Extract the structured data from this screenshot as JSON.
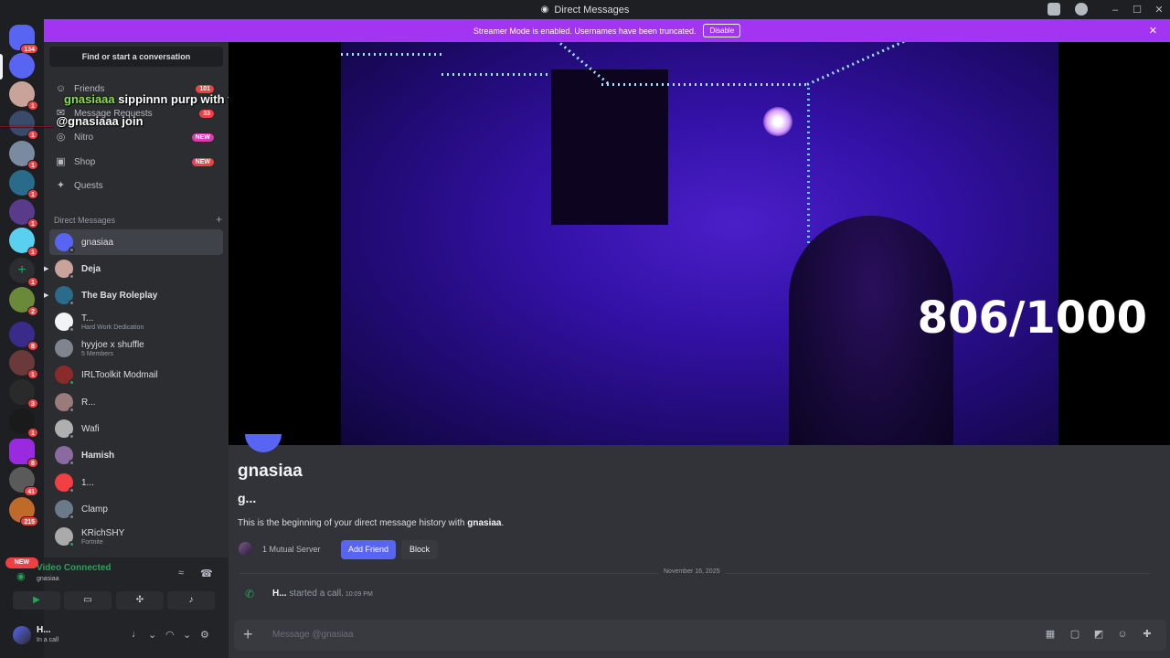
{
  "titlebar": {
    "title": "Direct Messages",
    "minimize": "–",
    "maximize": "☐",
    "close": "✕"
  },
  "streamer_mode": {
    "message": "Streamer Mode is enabled. Usernames have been truncated.",
    "disable_label": "Disable",
    "close": "✕"
  },
  "servers": {
    "home_badge": "134",
    "badges": [
      "1",
      "1",
      "1",
      "1",
      "1",
      "1",
      "1",
      "2",
      "8",
      "1",
      "3",
      "1",
      "8",
      "41",
      "215",
      "1"
    ],
    "new_label": "NEW"
  },
  "overlay_chat": [
    {
      "user": "gnasiaaa",
      "message": "sippinnn purp with the guysss"
    },
    {
      "user": "________",
      "message": "@gnasiaaa join"
    }
  ],
  "sidebar": {
    "find_label": "Find or start a conversation",
    "nav": [
      {
        "label": "Friends",
        "badge": "101",
        "icon": "friends-icon"
      },
      {
        "label": "Message Requests",
        "badge": "33",
        "icon": "mail-icon"
      },
      {
        "label": "Nitro",
        "badge": "NEW",
        "icon": "nitro-icon"
      },
      {
        "label": "Shop",
        "badge": "NEW",
        "icon": "shop-icon"
      },
      {
        "label": "Quests",
        "badge": "",
        "icon": "quests-icon"
      }
    ],
    "dm_header": "Direct Messages",
    "dm_header_plus": "+",
    "dms": [
      {
        "name": "gnasiaa",
        "sub": ""
      },
      {
        "name": "Deja",
        "sub": ""
      },
      {
        "name": "The Bay Roleplay",
        "sub": ""
      },
      {
        "name": "T...",
        "sub": "Hard Work Dedication"
      },
      {
        "name": "hyyjoe x shuffle",
        "sub": "5 Members"
      },
      {
        "name": "IRLToolkit Modmail",
        "sub": ""
      },
      {
        "name": "R...",
        "sub": ""
      },
      {
        "name": "Wafi",
        "sub": ""
      },
      {
        "name": "Hamish",
        "sub": ""
      },
      {
        "name": "1...",
        "sub": ""
      },
      {
        "name": "Clamp",
        "sub": ""
      },
      {
        "name": "KRichSHY",
        "sub": "Fortnite"
      }
    ]
  },
  "voice": {
    "status": "Video Connected",
    "channel": "gnasiaa",
    "buttons": [
      "video-icon",
      "screenshare-icon",
      "activities-icon",
      "soundboard-icon"
    ]
  },
  "me": {
    "name": "H...",
    "status": "In a call"
  },
  "stream": {
    "counter": "806/1000"
  },
  "profile": {
    "name": "gnasiaa",
    "handle": "g...",
    "begin_prefix": "This is the beginning of your direct message history with ",
    "begin_user": "gnasiaa",
    "begin_suffix": ".",
    "mutual": "1 Mutual Server",
    "add_friend": "Add Friend",
    "block": "Block"
  },
  "history": {
    "date": "November 16, 2025",
    "caller": "H...",
    "call_text": " started a call.",
    "time": "10:09 PM"
  },
  "composer": {
    "placeholder": "Message @gnasiaa",
    "plus": "+"
  },
  "colors": {
    "accent": "#5865f2",
    "streamer_bar": "#a334f2",
    "online": "#23a55a",
    "badge": "#f23f43"
  }
}
